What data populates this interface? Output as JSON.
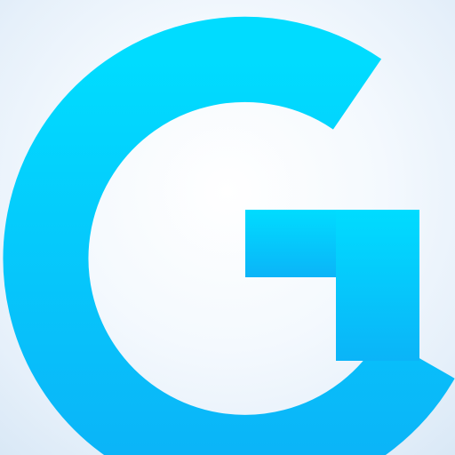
{
  "app_icon": {
    "icon_name": "letter-g-logo-icon",
    "letter": "G",
    "colors": {
      "background_center": "#ffffff",
      "background_edge": "#d9e8f6",
      "glyph_top": "#00dcff",
      "glyph_bottom": "#0bb4f8"
    }
  }
}
